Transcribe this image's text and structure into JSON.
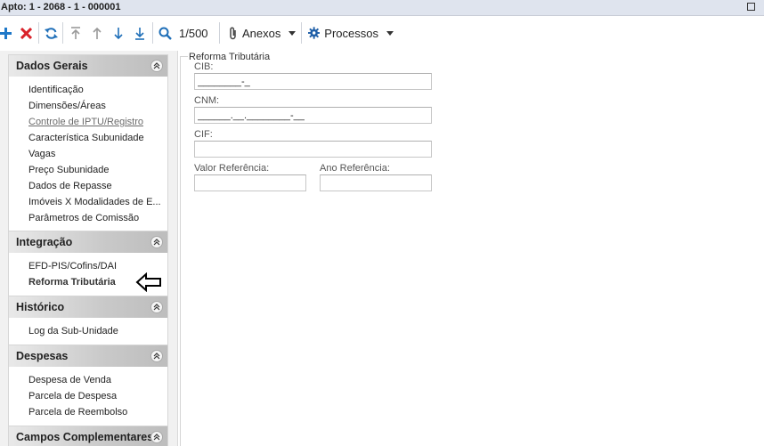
{
  "window": {
    "title": "Apto: 1 - 2068 - 1 - 000001"
  },
  "toolbar": {
    "pager": "1/500",
    "anexos_label": "Anexos",
    "processos_label": "Processos"
  },
  "sidebar": {
    "dados_gerais": {
      "title": "Dados Gerais",
      "items": [
        "Identificação",
        "Dimensões/Áreas",
        "Controle de IPTU/Registro",
        "Característica Subunidade",
        "Vagas",
        "Preço Subunidade",
        "Dados de Repasse",
        "Imóveis X Modalidades de E...",
        "Parâmetros de Comissão"
      ]
    },
    "integracao": {
      "title": "Integração",
      "items": [
        "EFD-PIS/Cofins/DAI",
        "Reforma Tributária"
      ]
    },
    "historico": {
      "title": "Histórico",
      "items": [
        "Log da Sub-Unidade"
      ]
    },
    "despesas": {
      "title": "Despesas",
      "items": [
        "Despesa de Venda",
        "Parcela de Despesa",
        "Parcela de Reembolso"
      ]
    },
    "campos": {
      "title": "Campos Complementares"
    }
  },
  "form": {
    "legend": "Reforma Tributária",
    "cib_label": "CIB:",
    "cib_value": "________-_",
    "cnm_label": "CNM:",
    "cnm_value": "______.__.________-__",
    "cif_label": "CIF:",
    "cif_value": "",
    "valor_label": "Valor Referência:",
    "valor_value": "",
    "ano_label": "Ano Referência:",
    "ano_value": ""
  },
  "colors": {
    "add": "#1f78c8",
    "delete": "#d9222a",
    "accent_blue": "#1f6fb8"
  }
}
